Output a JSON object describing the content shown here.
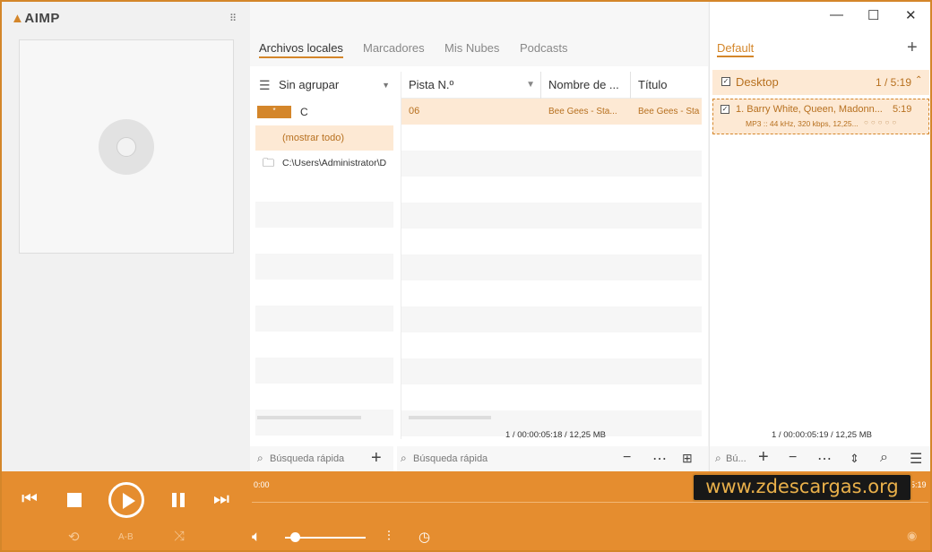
{
  "app": {
    "logo": "AIMP"
  },
  "tabs": [
    {
      "label": "Archivos locales",
      "active": true
    },
    {
      "label": "Marcadores"
    },
    {
      "label": "Mis Nubes"
    },
    {
      "label": "Podcasts"
    }
  ],
  "tree": {
    "grouping": "Sin agrupar",
    "drive_label": "C",
    "show_all": "(mostrar todo)",
    "folder_path": "C:\\Users\\Administrator\\D"
  },
  "table": {
    "columns": [
      "Pista N.º",
      "Nombre de ...",
      "Título"
    ],
    "rows": [
      {
        "track_no": "06",
        "name": "Bee Gees - Sta...",
        "title": "Bee Gees - Sta"
      }
    ]
  },
  "middle_status": "1 / 00:00:05:18 / 12,25 MB",
  "search": {
    "placeholder": "Búsqueda rápida",
    "right_placeholder": "Bú..."
  },
  "playlist": {
    "tab": "Default",
    "group_title": "Desktop",
    "group_info": "1 / 5:19",
    "track_title": "1. Barry White, Queen, Madonn...",
    "track_duration": "5:19",
    "track_meta": "MP3 :: 44 kHz, 320 kbps, 12,25...",
    "rating_stars": "○○○○○",
    "status": "1 / 00:00:05:19 / 12,25 MB"
  },
  "player": {
    "time_current": "0:00",
    "time_total": "5:19",
    "ab_label": "A-B",
    "volume_level": 0.12
  },
  "watermark": "www.zdescargas.org",
  "colors": {
    "accent": "#e58d2f",
    "highlight": "#fde9d4",
    "accent_text": "#b7701f"
  }
}
